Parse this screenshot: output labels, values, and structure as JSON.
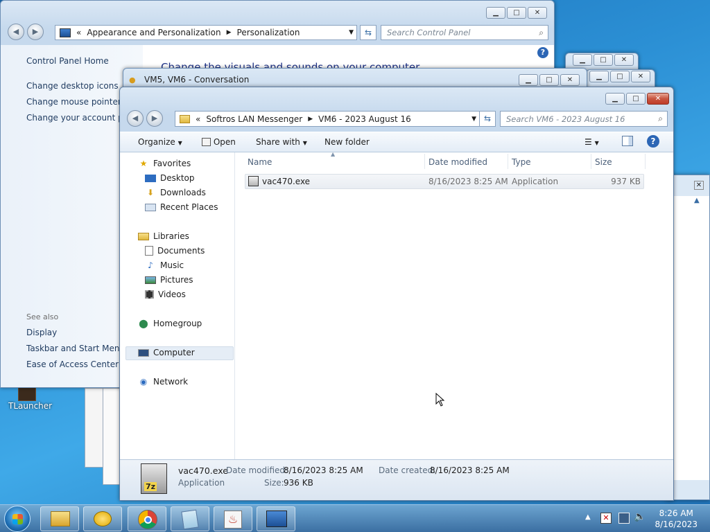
{
  "desktop": {
    "icon_label": "TLauncher"
  },
  "control_panel": {
    "breadcrumb_sep": "«",
    "breadcrumb": [
      "Appearance and Personalization",
      "Personalization"
    ],
    "search_placeholder": "Search Control Panel",
    "heading": "Change the visuals and sounds on your computer",
    "home_link": "Control Panel Home",
    "links": [
      "Change desktop icons",
      "Change mouse pointers",
      "Change your account pict"
    ],
    "see_also_label": "See also",
    "see_also": [
      "Display",
      "Taskbar and Start Menu",
      "Ease of Access Center"
    ]
  },
  "conversation_window": {
    "title": "VM5, VM6 - Conversation"
  },
  "explorer": {
    "breadcrumb_sep": "«",
    "breadcrumb": [
      "Softros LAN Messenger",
      "VM6 - 2023 August 16"
    ],
    "search_placeholder": "Search VM6 - 2023 August 16",
    "toolbar": {
      "organize": "Organize",
      "open": "Open",
      "share_with": "Share with",
      "new_folder": "New folder"
    },
    "nav": {
      "favorites": "Favorites",
      "desktop": "Desktop",
      "downloads": "Downloads",
      "recent_places": "Recent Places",
      "libraries": "Libraries",
      "documents": "Documents",
      "music": "Music",
      "pictures": "Pictures",
      "videos": "Videos",
      "homegroup": "Homegroup",
      "computer": "Computer",
      "network": "Network"
    },
    "columns": {
      "name": "Name",
      "date_modified": "Date modified",
      "type": "Type",
      "size": "Size"
    },
    "files": [
      {
        "name": "vac470.exe",
        "date_modified": "8/16/2023 8:25 AM",
        "type": "Application",
        "size": "937 KB"
      }
    ],
    "details": {
      "name": "vac470.exe",
      "type": "Application",
      "date_modified_label": "Date modified:",
      "date_modified": "8/16/2023 8:25 AM",
      "date_created_label": "Date created:",
      "date_created": "8/16/2023 8:25 AM",
      "size_label": "Size:",
      "size": "936 KB"
    }
  },
  "taskbar": {
    "time": "8:26 AM",
    "date": "8/16/2023"
  }
}
